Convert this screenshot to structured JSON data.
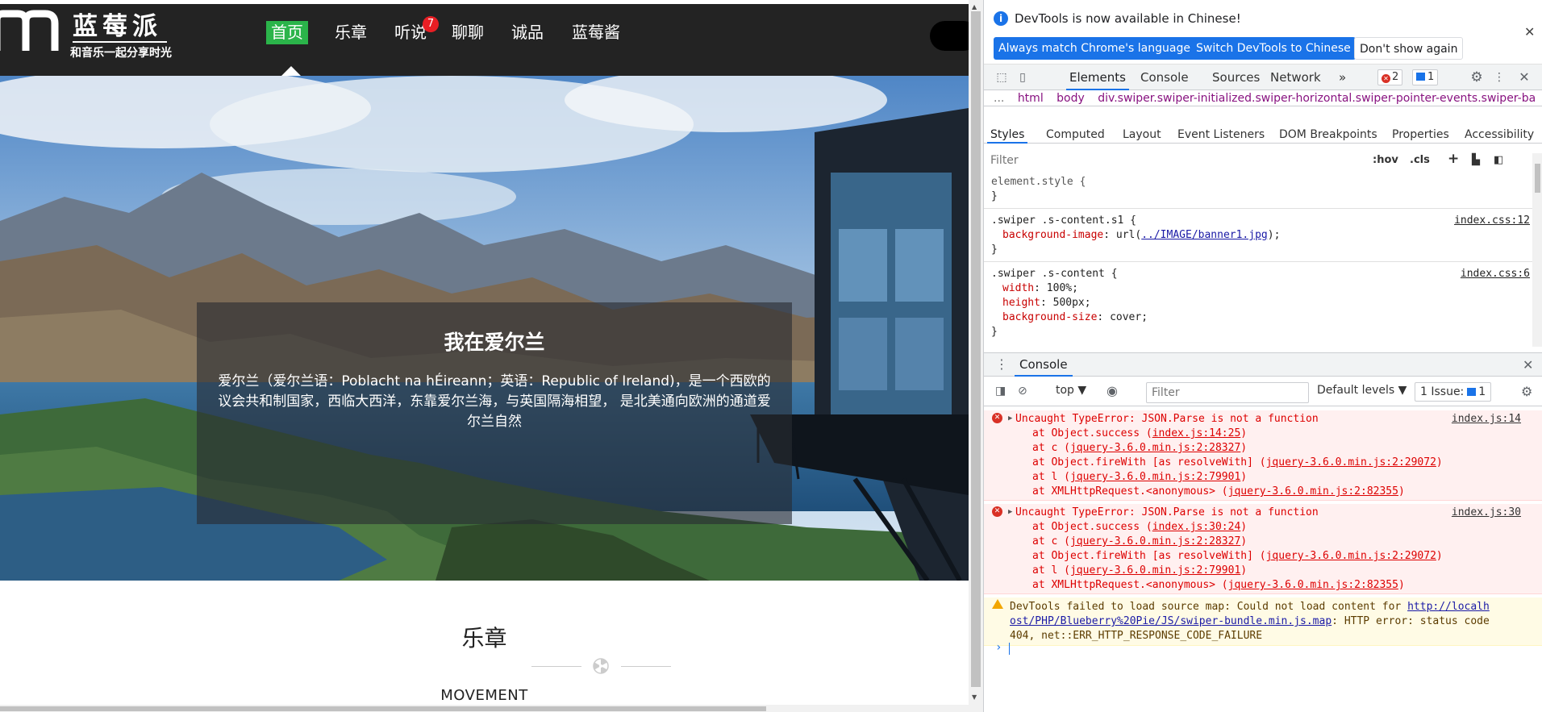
{
  "site": {
    "logo": {
      "title": "蓝莓派",
      "subtitle": "和音乐一起分享时光"
    },
    "nav": {
      "items": [
        {
          "label": "首页",
          "active": true
        },
        {
          "label": "乐章",
          "active": false
        },
        {
          "label": "听说",
          "active": false
        },
        {
          "label": "聊聊",
          "active": false
        },
        {
          "label": "诚品",
          "active": false
        },
        {
          "label": "蓝莓酱",
          "active": false
        }
      ],
      "badge": "7"
    },
    "banner": {
      "title": "我在爱尔兰",
      "text": "爱尔兰（爱尔兰语：Poblacht na hÉireann；英语：Republic of Ireland)，是一个西欧的议会共和制国家，西临大西洋，东靠爱尔兰海，与英国隔海相望， 是北美通向欧洲的通道爱尔兰自然"
    },
    "section": {
      "title": "乐章",
      "subtitle": "MOVEMENT"
    }
  },
  "devtools": {
    "infobar": {
      "text": "DevTools is now available in Chinese!",
      "btn_match": "Always match Chrome's language",
      "btn_switch": "Switch DevTools to Chinese",
      "btn_dismiss": "Don't show again"
    },
    "tabs": [
      "Elements",
      "Console",
      "Sources",
      "Network"
    ],
    "more_tabs": "»",
    "error_count": "2",
    "message_count": "1",
    "breadcrumb": [
      "...",
      "html",
      "body",
      "div.swiper.swiper-initialized.swiper-horizontal.swiper-pointer-events.swiper-ba"
    ],
    "subtabs": [
      "Styles",
      "Computed",
      "Layout",
      "Event Listeners",
      "DOM Breakpoints",
      "Properties",
      "Accessibility"
    ],
    "styles_filter_placeholder": "Filter",
    "filter_buttons": {
      "hov": ":hov",
      "cls": ".cls",
      "add": "+"
    },
    "rules": {
      "element_style": "element.style {",
      "close": "}",
      "r1": {
        "selector": ".swiper .s-content.s1 {",
        "source": "index.css:12",
        "prop": "background-image",
        "value_prefix": "url(",
        "url": "../IMAGE/banner1.jpg",
        "value_suffix": ");"
      },
      "r2": {
        "selector": ".swiper .s-content {",
        "source": "index.css:6",
        "p1": "width",
        "v1": "100%;",
        "p2": "height",
        "v2": "500px;",
        "p3": "background-size",
        "v3": "cover;"
      }
    },
    "drawer": {
      "tab": "Console",
      "context": "top ▼",
      "filter_placeholder": "Filter",
      "levels": "Default levels ▼",
      "issues_label": "1 Issue:",
      "issues_count": "1"
    },
    "console": {
      "error1": {
        "message": "Uncaught TypeError: JSON.Parse is not a function",
        "location": "index.js:14",
        "frames": [
          {
            "pre": "at Object.success (",
            "link": "index.js:14:25",
            "post": ")"
          },
          {
            "pre": "at c (",
            "link": "jquery-3.6.0.min.js:2:28327",
            "post": ")"
          },
          {
            "pre": "at Object.fireWith [as resolveWith] (",
            "link": "jquery-3.6.0.min.js:2:29072",
            "post": ")"
          },
          {
            "pre": "at l (",
            "link": "jquery-3.6.0.min.js:2:79901",
            "post": ")"
          },
          {
            "pre": "at XMLHttpRequest.<anonymous> (",
            "link": "jquery-3.6.0.min.js:2:82355",
            "post": ")"
          }
        ]
      },
      "error2": {
        "message": "Uncaught TypeError: JSON.Parse is not a function",
        "location": "index.js:30",
        "frames": [
          {
            "pre": "at Object.success (",
            "link": "index.js:30:24",
            "post": ")"
          },
          {
            "pre": "at c (",
            "link": "jquery-3.6.0.min.js:2:28327",
            "post": ")"
          },
          {
            "pre": "at Object.fireWith [as resolveWith] (",
            "link": "jquery-3.6.0.min.js:2:29072",
            "post": ")"
          },
          {
            "pre": "at l (",
            "link": "jquery-3.6.0.min.js:2:79901",
            "post": ")"
          },
          {
            "pre": "at XMLHttpRequest.<anonymous> (",
            "link": "jquery-3.6.0.min.js:2:82355",
            "post": ")"
          }
        ]
      },
      "warning": {
        "pre": "DevTools failed to load source map: Could not load content for ",
        "link_line1": "http://localh",
        "link_line2": "ost/PHP/Blueberry%20Pie/JS/swiper-bundle.min.js.map",
        "post_line2": ": HTTP error: status code",
        "line3": "404, net::ERR_HTTP_RESPONSE_CODE_FAILURE"
      },
      "prompt": "›"
    }
  },
  "colors": {
    "nav_active": "#2bb44a",
    "badge": "#e81e24",
    "accent": "#1a73e8",
    "error": "#d00000"
  }
}
